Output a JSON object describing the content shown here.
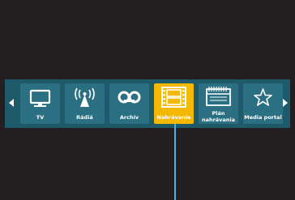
{
  "menu": {
    "items": [
      {
        "label": "TV",
        "icon": "tv-icon"
      },
      {
        "label": "Rádiá",
        "icon": "radio-antenna-icon"
      },
      {
        "label": "Archív",
        "icon": "cassette-tape-icon"
      },
      {
        "label": "Nahrávanie",
        "icon": "film-strip-icon",
        "selected": true
      },
      {
        "label_line1": "Plán",
        "label_line2": "nahrávania",
        "icon": "calendar-icon"
      },
      {
        "label": "Media portal",
        "icon": "star-icon"
      }
    ],
    "prev": "arrow-left-icon",
    "next": "arrow-right-icon"
  },
  "colors": {
    "background": "#231f20",
    "bar": "#1f5a6a",
    "tile": "#2b7082",
    "selected": "#f5b800",
    "connector": "#3fb4e6"
  }
}
